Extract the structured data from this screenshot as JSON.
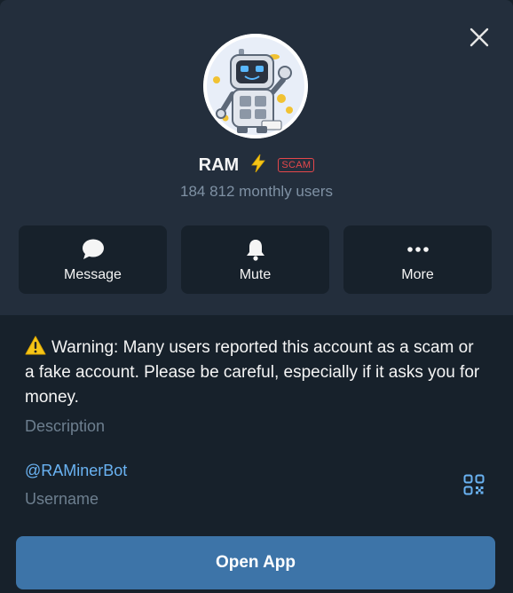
{
  "profile": {
    "name": "RAM",
    "emoji_status_icon": "lightning-bolt-icon",
    "badge": "SCAM",
    "subtitle": "184 812 monthly users"
  },
  "actions": [
    {
      "label": "Message",
      "icon": "chat-bubble-icon"
    },
    {
      "label": "Mute",
      "icon": "bell-icon"
    },
    {
      "label": "More",
      "icon": "more-dots-icon"
    }
  ],
  "info": {
    "warning_text": "Warning: Many users reported this account as a scam or a fake account. Please be careful, especially if it asks you for money.",
    "description_label": "Description",
    "username_value": "@RAMinerBot",
    "username_label": "Username"
  },
  "footer": {
    "open_app_label": "Open App"
  },
  "colors": {
    "background": "#17212b",
    "header": "#232e3c",
    "accent": "#3d74a8",
    "link": "#6ab3f3",
    "scam_red": "#e5474b",
    "muted_text": "#7f91a4"
  }
}
